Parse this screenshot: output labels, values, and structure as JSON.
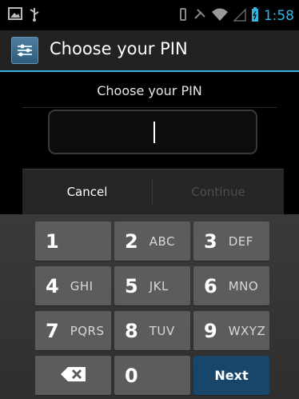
{
  "status_bar": {
    "time": "1:58",
    "left_icons": [
      "image-icon",
      "usb-icon"
    ],
    "right_icons": [
      "vibrate-icon",
      "no-signal-icon",
      "wifi-icon",
      "cell-signal-icon",
      "battery-icon"
    ],
    "accent_color": "#33b5e5"
  },
  "action_bar": {
    "title": "Choose your PIN",
    "icon": "settings-app-icon"
  },
  "header": {
    "label": "Choose your PIN"
  },
  "pin_field": {
    "value": ""
  },
  "buttons": {
    "cancel": "Cancel",
    "continue": "Continue"
  },
  "keypad": {
    "rows": [
      [
        {
          "num": "1",
          "letters": ""
        },
        {
          "num": "2",
          "letters": "ABC"
        },
        {
          "num": "3",
          "letters": "DEF"
        }
      ],
      [
        {
          "num": "4",
          "letters": "GHI"
        },
        {
          "num": "5",
          "letters": "JKL"
        },
        {
          "num": "6",
          "letters": "MNO"
        }
      ],
      [
        {
          "num": "7",
          "letters": "PQRS"
        },
        {
          "num": "8",
          "letters": "TUV"
        },
        {
          "num": "9",
          "letters": "WXYZ"
        }
      ]
    ],
    "zero": "0",
    "next": "Next",
    "delete_icon": "backspace-icon",
    "next_color": "#18456a"
  }
}
